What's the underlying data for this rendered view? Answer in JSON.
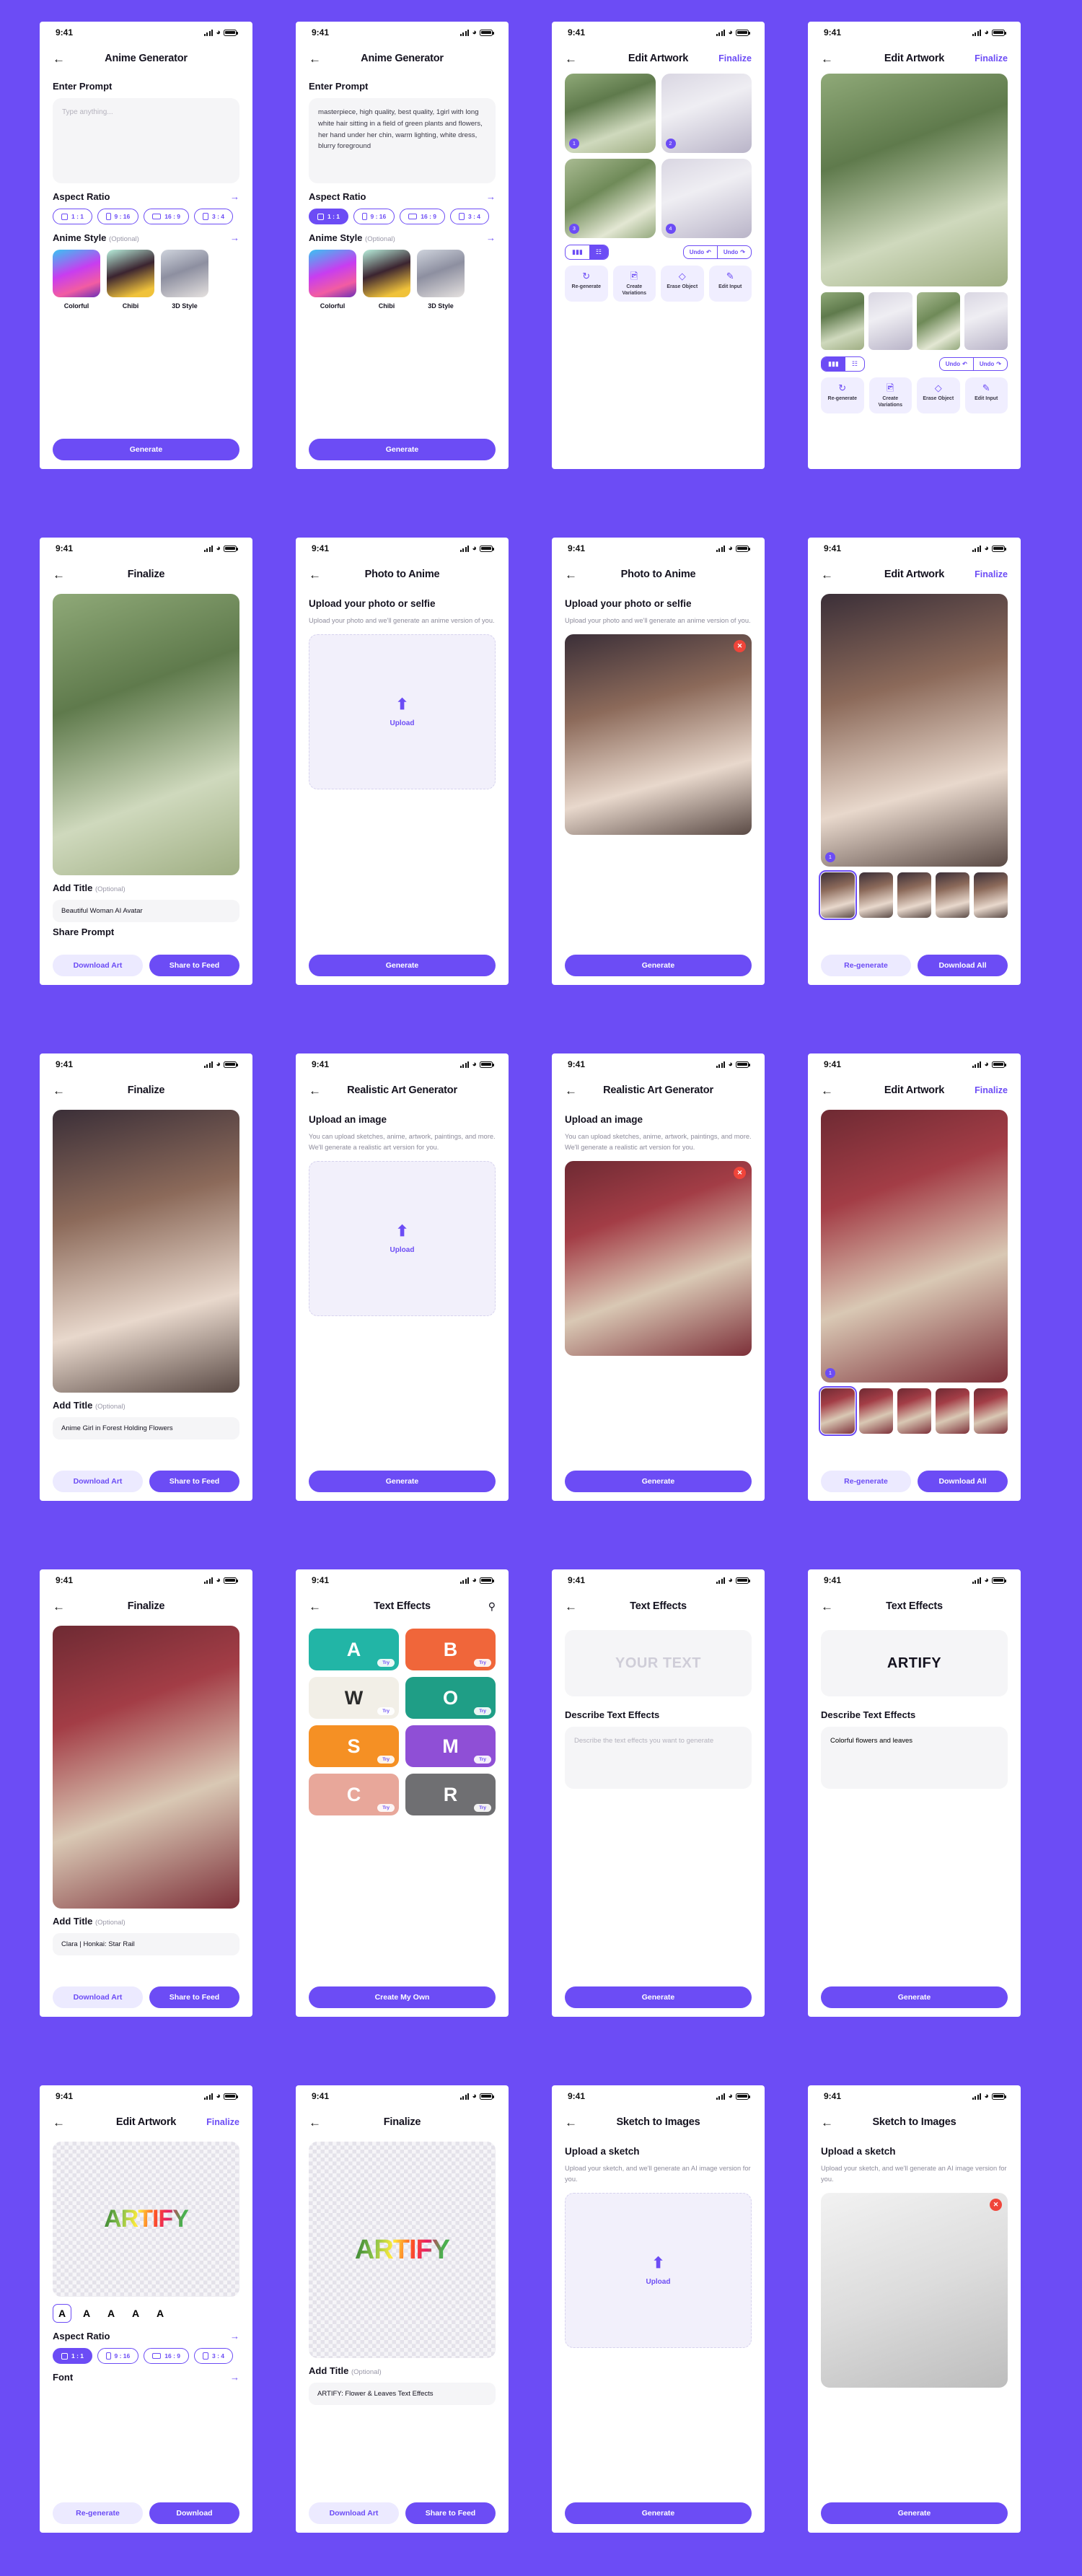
{
  "theme": {
    "accent": "#6C4CF5",
    "bg": "#6C4CF5",
    "card": "#FFFFFF",
    "muted": "#8D8B9B",
    "danger": "#F0453A"
  },
  "status": {
    "time": "9:41"
  },
  "common": {
    "back_icon": "arrow-left-icon",
    "finalize": "Finalize",
    "generate": "Generate",
    "optional": "(Optional)",
    "add_title": "Add Title",
    "download_art": "Download Art",
    "share_to_feed": "Share to Feed",
    "re_generate": "Re-generate",
    "download_all": "Download All",
    "download": "Download",
    "upload": "Upload",
    "undo": "Undo",
    "redo": "Undo"
  },
  "aspect": {
    "label": "Aspect Ratio",
    "options": [
      {
        "label": "1 : 1",
        "shape": "square"
      },
      {
        "label": "9 : 16",
        "shape": "portrait"
      },
      {
        "label": "16 : 9",
        "shape": "landscape"
      },
      {
        "label": "3 : 4",
        "shape": "tall"
      }
    ]
  },
  "anime_style": {
    "label": "Anime Style",
    "items": [
      {
        "name": "Colorful"
      },
      {
        "name": "Chibi"
      },
      {
        "name": "3D Style"
      }
    ]
  },
  "screens": [
    {
      "id": "anime-generator-empty",
      "title": "Anime Generator",
      "prompt_label": "Enter Prompt",
      "prompt_placeholder": "Type anything...",
      "prompt_value": "",
      "selected_ratio": -1,
      "cta": "Generate"
    },
    {
      "id": "anime-generator-filled",
      "title": "Anime Generator",
      "prompt_label": "Enter Prompt",
      "prompt_value": "masterpiece, high quality, best quality, 1girl with long white hair sitting in a field of green plants and flowers, her hand under her chin, warm lighting, white dress, blurry foreground",
      "selected_ratio": 0,
      "cta": "Generate"
    },
    {
      "id": "edit-artwork-grid",
      "title": "Edit Artwork",
      "action": "Finalize",
      "view_mode": "grid",
      "undo": "Undo",
      "redo": "Undo",
      "tools": [
        {
          "icon": "refresh-icon",
          "label": "Re-generate"
        },
        {
          "icon": "image-variations-icon",
          "label": "Create Variations"
        },
        {
          "icon": "eraser-icon",
          "label": "Erase Object"
        },
        {
          "icon": "edit-input-icon",
          "label": "Edit Input"
        }
      ],
      "badges": [
        "1",
        "2",
        "3",
        "4"
      ]
    },
    {
      "id": "edit-artwork-single",
      "title": "Edit Artwork",
      "action": "Finalize",
      "view_mode": "single",
      "undo": "Undo",
      "redo": "Undo",
      "tools": [
        {
          "icon": "refresh-icon",
          "label": "Re-generate"
        },
        {
          "icon": "image-variations-icon",
          "label": "Create Variations"
        },
        {
          "icon": "eraser-icon",
          "label": "Erase Object"
        },
        {
          "icon": "edit-input-icon",
          "label": "Edit Input"
        }
      ]
    },
    {
      "id": "finalize-anime-girl",
      "title": "Finalize",
      "add_title_label": "Add Title",
      "title_value": "Beautiful Woman AI Avatar",
      "extra_line": "Share Prompt",
      "buttons": [
        "Download Art",
        "Share to Feed"
      ]
    },
    {
      "id": "photo-to-anime-empty",
      "title": "Photo to Anime",
      "heading": "Upload your photo or selfie",
      "helper": "Upload your photo and we'll generate an anime version of you.",
      "upload_label": "Upload",
      "cta": "Generate"
    },
    {
      "id": "photo-to-anime-filled",
      "title": "Photo to Anime",
      "heading": "Upload your photo or selfie",
      "helper": "Upload your photo and we'll generate an anime version of you.",
      "cta": "Generate"
    },
    {
      "id": "edit-artwork-photo",
      "title": "Edit Artwork",
      "action": "Finalize",
      "buttons": [
        "Re-generate",
        "Download All"
      ]
    },
    {
      "id": "finalize-forest-girl",
      "title": "Finalize",
      "add_title_label": "Add Title",
      "title_value": "Anime Girl in Forest Holding Flowers",
      "buttons": [
        "Download Art",
        "Share to Feed"
      ]
    },
    {
      "id": "realistic-art-empty",
      "title": "Realistic Art Generator",
      "heading": "Upload an image",
      "helper": "You can upload sketches, anime, artwork, paintings, and more. We'll generate a realistic art version for you.",
      "upload_label": "Upload",
      "cta": "Generate"
    },
    {
      "id": "realistic-art-filled",
      "title": "Realistic Art Generator",
      "heading": "Upload an image",
      "helper": "You can upload sketches, anime, artwork, paintings, and more. We'll generate a realistic art version for you.",
      "cta": "Generate"
    },
    {
      "id": "edit-artwork-realistic",
      "title": "Edit Artwork",
      "action": "Finalize",
      "buttons": [
        "Re-generate",
        "Download All"
      ]
    },
    {
      "id": "finalize-clara",
      "title": "Finalize",
      "add_title_label": "Add Title",
      "title_value": "Clara | Honkai: Star Rail",
      "buttons": [
        "Download Art",
        "Share to Feed"
      ]
    },
    {
      "id": "text-effects-gallery",
      "title": "Text Effects",
      "search_icon": "search-icon",
      "cards": [
        {
          "letter": "A",
          "try": "Try",
          "bg": "#22b5a6",
          "color": "#ffffff"
        },
        {
          "letter": "B",
          "try": "Try",
          "bg": "#f0663a",
          "color": "#ffffff"
        },
        {
          "letter": "W",
          "try": "Try",
          "bg": "#f2efe7",
          "color": "#2b2b2b"
        },
        {
          "letter": "O",
          "try": "Try",
          "bg": "#1f9e86",
          "color": "#ffffff"
        },
        {
          "letter": "S",
          "try": "Try",
          "bg": "#f59024",
          "color": "#ffffff"
        },
        {
          "letter": "M",
          "try": "Try",
          "bg": "#8f4fd6",
          "color": "#ffffff"
        },
        {
          "letter": "C",
          "try": "Try",
          "bg": "#e8a79a",
          "color": "#ffffff"
        },
        {
          "letter": "R",
          "try": "Try",
          "bg": "#6f6f72",
          "color": "#ffffff"
        }
      ],
      "cta": "Create My Own"
    },
    {
      "id": "text-effects-empty",
      "title": "Text Effects",
      "preview_text": "YOUR TEXT",
      "describe_label": "Describe Text Effects",
      "describe_placeholder": "Describe the text effects you want to generate",
      "cta": "Generate"
    },
    {
      "id": "text-effects-filled",
      "title": "Text Effects",
      "preview_text": "ARTIFY",
      "describe_label": "Describe Text Effects",
      "describe_value": "Colorful flowers and leaves",
      "cta": "Generate"
    },
    {
      "id": "edit-artwork-text",
      "title": "Edit Artwork",
      "action": "Finalize",
      "word": "ARTIFY",
      "font_label": "Font",
      "font_samples": [
        "A",
        "A",
        "A",
        "A",
        "A"
      ],
      "selected_ratio": 0,
      "buttons": [
        "Re-generate",
        "Download"
      ]
    },
    {
      "id": "finalize-text",
      "title": "Finalize",
      "word": "ARTIFY",
      "add_title_label": "Add Title",
      "title_value": "ARTIFY: Flower & Leaves Text Effects",
      "buttons": [
        "Download Art",
        "Share to Feed"
      ]
    },
    {
      "id": "sketch-to-images-empty",
      "title": "Sketch to Images",
      "heading": "Upload a sketch",
      "helper": "Upload your sketch, and we'll generate an AI image version for you.",
      "upload_label": "Upload",
      "cta": "Generate"
    },
    {
      "id": "sketch-to-images-filled",
      "title": "Sketch to Images",
      "heading": "Upload a sketch",
      "helper": "Upload your sketch, and we'll generate an AI image version for you.",
      "cta": "Generate"
    }
  ]
}
